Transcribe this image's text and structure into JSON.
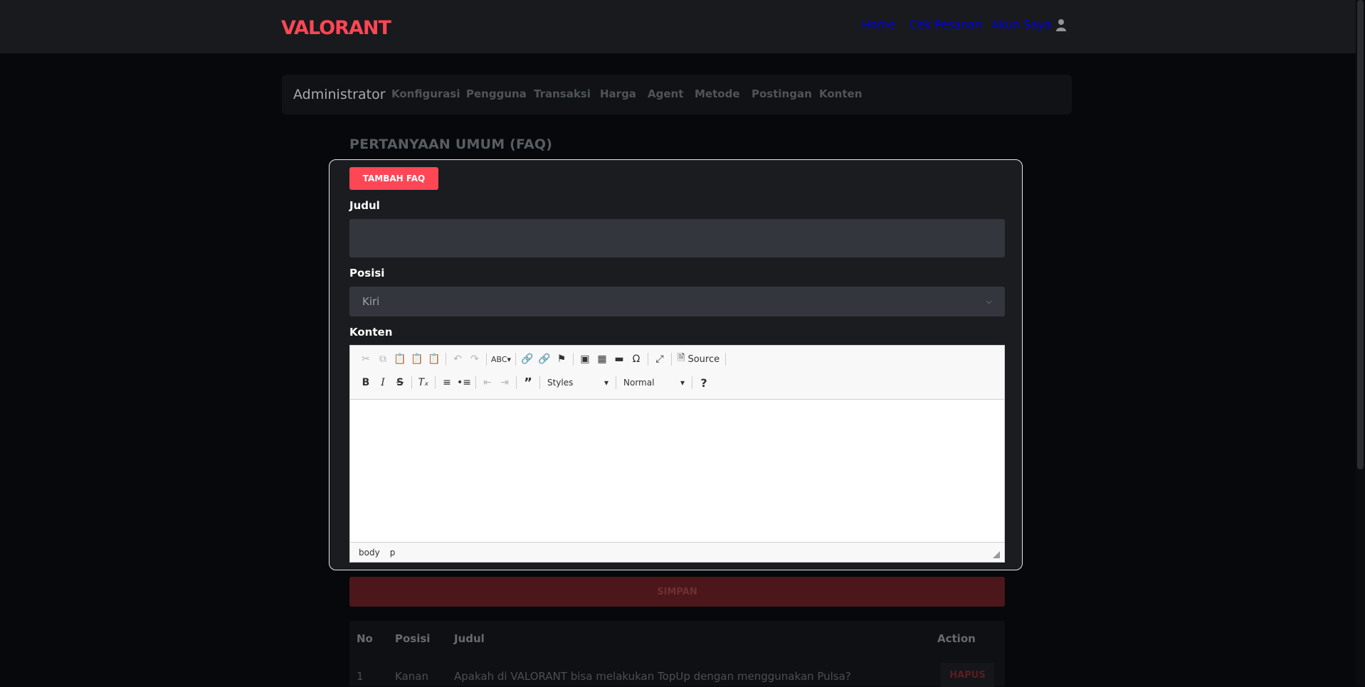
{
  "brand": {
    "logo_text": "VALORANT",
    "accent": "#ff4655"
  },
  "topnav": {
    "home": "Home",
    "cek_pesanan": "Cek Pesanan",
    "akun": "Akun Saya",
    "user_icon": "user-icon"
  },
  "admin": {
    "brand": "Administrator",
    "menu": [
      "Konfigurasi",
      "Pengguna",
      "Transaksi",
      "Harga",
      "Agent",
      "Metode",
      "Postingan",
      "Konten"
    ]
  },
  "page": {
    "title": "PERTANYAAN UMUM (FAQ)"
  },
  "form": {
    "add_button": "TAMBAH FAQ",
    "judul_label": "Judul",
    "judul_value": "",
    "posisi_label": "Posisi",
    "posisi_value": "Kiri",
    "konten_label": "Konten",
    "save_button": "SIMPAN"
  },
  "editor": {
    "source_label": "Source",
    "styles_label": "Styles",
    "format_label": "Normal",
    "help_label": "?",
    "path": [
      "body",
      "p"
    ]
  },
  "table": {
    "headers": {
      "no": "No",
      "posisi": "Posisi",
      "judul": "Judul",
      "action": "Action"
    },
    "rows": [
      {
        "no": "1",
        "posisi": "Kanan",
        "judul": "Apakah di VALORANT bisa melakukan TopUp dengan menggunakan Pulsa?",
        "action": "HAPUS"
      }
    ]
  }
}
